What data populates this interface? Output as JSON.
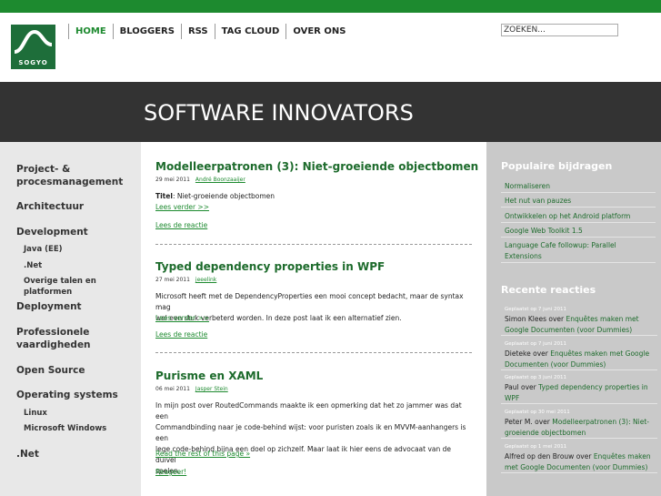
{
  "logo": {
    "text": "SOGYO"
  },
  "nav": {
    "items": [
      {
        "label": "HOME",
        "active": true
      },
      {
        "label": "BLOGGERS",
        "active": false
      },
      {
        "label": "RSS",
        "active": false
      },
      {
        "label": "TAG CLOUD",
        "active": false
      },
      {
        "label": "OVER ONS",
        "active": false
      }
    ]
  },
  "search": {
    "value": "ZOEKEN..."
  },
  "banner": {
    "title": "SOFTWARE INNOVATORS"
  },
  "left_sidebar": {
    "categories": [
      {
        "label": "Project- &"
      },
      {
        "label": "procesmanagement"
      },
      {
        "label": "Architectuur"
      },
      {
        "label": "Development"
      },
      {
        "label": "Java (EE)"
      },
      {
        "label": ".Net"
      },
      {
        "label": "Overige talen en platformen"
      },
      {
        "label": "Deployment"
      },
      {
        "label": "Professionele"
      },
      {
        "label": "vaardigheden"
      },
      {
        "label": "Open Source"
      },
      {
        "label": "Operating systems"
      },
      {
        "label": "Linux"
      },
      {
        "label": "Microsoft Windows"
      },
      {
        "label": ".Net"
      }
    ]
  },
  "posts": [
    {
      "title": "Modelleerpatronen (3): Niet-groeiende objectbomen",
      "date": "29 mei 2011",
      "author": "André Boonzaaijer",
      "body_label": "Titel",
      "body": ": Niet-groeiende objectbomen",
      "more": "Lees verder >>",
      "reply": "Lees de reactie"
    },
    {
      "title": "Typed dependency properties in WPF",
      "date": "27 mei 2011",
      "author": "jeeelink",
      "body_line1": "Microsoft heeft met de DependencyProperties een mooi concept bedacht, maar de syntax mag",
      "body_line2": "wel een stuk verbeterd worden. In deze post laat ik een alternatief zien.",
      "more": "Lees verder >>",
      "reply": "Lees de reactie"
    },
    {
      "title": "Purisme en XAML",
      "date": "06 mei 2011",
      "author": "Jasper Stein",
      "body_line1": "In mijn post over RoutedCommands maakte ik een opmerking dat het zo jammer was dat een",
      "body_line2": "Commandbinding naar je code-behind wijst: voor puristen zoals ik en MVVM-aanhangers is een",
      "body_line3": "lege code-behind bijna een doel op zichzelf. Maar laat ik hier eens de advocaat van de duivel",
      "body_line4": "spelen.",
      "more": "Read the rest of this page »",
      "reply": "Reageer!"
    }
  ],
  "right_sidebar": {
    "popular_heading": "Populaire bijdragen",
    "popular": [
      {
        "line1": "Normaliseren"
      },
      {
        "line1": "Het nut van pauzes"
      },
      {
        "line1": "Ontwikkelen op het Android platform"
      },
      {
        "line1": "Google Web Toolkit 1.5"
      },
      {
        "line1": "Language Cafe followup: Parallel",
        "line2": "Extensions"
      }
    ],
    "reactions_heading": "Recente reacties",
    "reactions": [
      {
        "date": "Geplaatst op 7 juni 2011",
        "who": "Simon Klees over ",
        "post1": "Enquêtes maken met",
        "post2": "Google Documenten (voor Dummies)"
      },
      {
        "date": "Geplaatst op 7 juni 2011",
        "who": "Dieteke over ",
        "post1": "Enquêtes maken met Google",
        "post2": "Documenten (voor Dummies)"
      },
      {
        "date": "Geplaatst op 3 juni 2011",
        "who": "Paul over ",
        "post1": "Typed dependency properties in",
        "post2": "WPF"
      },
      {
        "date": "Geplaatst op 30 mei 2011",
        "who": "Peter M. over ",
        "post1": "Modelleerpatronen (3): Niet-",
        "post2": "groeiende objectbomen"
      },
      {
        "date": "Geplaatst op 1 mei 2011",
        "who": "Alfred op den Brouw over ",
        "post1": "Enquêtes maken",
        "post2": "met Google Documenten (voor Dummies)"
      }
    ]
  },
  "colors": {
    "accent": "#1d8a2f",
    "banner": "#333333",
    "sidebar_left": "#e8e8e8",
    "sidebar_right": "#c9c9c9"
  }
}
